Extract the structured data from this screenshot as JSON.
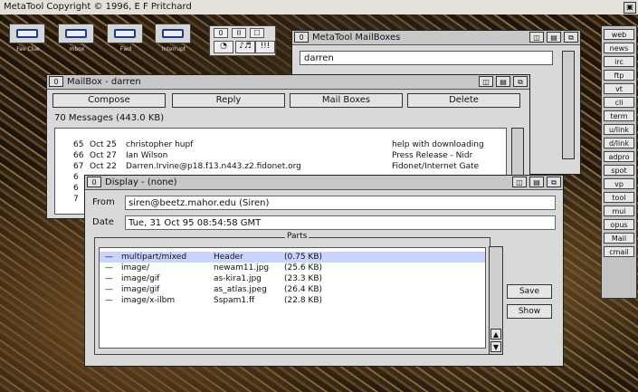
{
  "copyright": "MetaTool Copyright © 1996, E F Pritchard",
  "icons": [
    {
      "label": "Fav Clue"
    },
    {
      "label": "mbox"
    },
    {
      "label": "Fwd"
    },
    {
      "label": "Interrupt"
    }
  ],
  "toolpanel": {
    "b1": "0",
    "b2": "II",
    "b3": "☐",
    "b4": "♪♬",
    "b5": "!!!"
  },
  "mailboxes_window": {
    "title": "MetaTool MailBoxes",
    "selected": "darren"
  },
  "mailbox_window": {
    "title": "MailBox - darren",
    "buttons": [
      "Compose",
      "Reply",
      "Mail Boxes",
      "Delete"
    ],
    "count": "70 Messages (443.0 KB)",
    "messages": [
      {
        "num": "65",
        "date": "Oct 25",
        "from": "christopher hupf",
        "subject": "help with downloading"
      },
      {
        "num": "66",
        "date": "Oct 27",
        "from": "Ian Wilson",
        "subject": "Press Release - Nidr"
      },
      {
        "num": "67",
        "date": "Oct 22",
        "from": "Darren.Irvine@p18.f13.n443.z2.fidonet.org",
        "subject": "Fidonet/Internet Gate"
      },
      {
        "num": "6",
        "date": "",
        "from": "",
        "subject": ""
      },
      {
        "num": "6",
        "date": "",
        "from": "",
        "subject": ""
      },
      {
        "num": "7",
        "date": "",
        "from": "",
        "subject": ""
      }
    ]
  },
  "display_window": {
    "title": "Display - (none)",
    "from_label": "From",
    "from_value": "siren@beetz.mahor.edu (Siren)",
    "date_label": "Date",
    "date_value": "Tue, 31 Oct 95 08:54:58 GMT",
    "parts_label": "Parts",
    "parts": [
      {
        "type": "multipart/mixed",
        "name": "Header",
        "size": "(0.75 KB)"
      },
      {
        "type": "image/",
        "name": "newam11.jpg",
        "size": "(25.6 KB)"
      },
      {
        "type": "image/gif",
        "name": "as-kira1.jpg",
        "size": "(23.3 KB)"
      },
      {
        "type": "image/gif",
        "name": "as_atlas.jpeg",
        "size": "(26.4 KB)"
      },
      {
        "type": "image/x-ilbm",
        "name": "Sspam1.ff",
        "size": "(22.8 KB)"
      }
    ],
    "save_label": "Save",
    "show_label": "Show"
  },
  "sidebar": [
    "web",
    "news",
    "irc",
    "ftp",
    "vt",
    "cli",
    "term",
    "u/link",
    "d/link",
    "adpro",
    "spot",
    "vp",
    "tool",
    "mui",
    "opus",
    "Mail",
    "cmail"
  ]
}
